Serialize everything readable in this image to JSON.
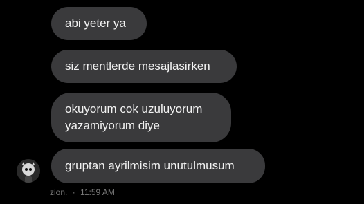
{
  "messages": [
    {
      "lines": [
        "abi yeter ya"
      ]
    },
    {
      "lines": [
        "siz mentlerde mesajlasirken"
      ]
    },
    {
      "lines": [
        "okuyorum cok uzuluyorum",
        "yazamiyorum diye"
      ]
    },
    {
      "lines": [
        "gruptan ayrilmisim unutulmusum"
      ]
    }
  ],
  "sender": {
    "name": "zion.",
    "separator": "·",
    "time": "11:59 AM",
    "avatar_icon": "user-avatar-icon"
  },
  "colors": {
    "background": "#000000",
    "bubble": "#3a3a3c",
    "bubble_text": "#f2f2f2",
    "meta_text": "#7a7a7a"
  }
}
